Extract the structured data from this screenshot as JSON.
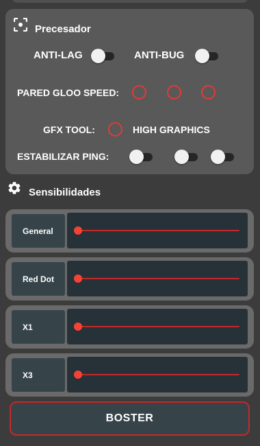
{
  "colors": {
    "background": "#3c3c3c",
    "panel": "#595959",
    "accent": "#e53935",
    "slider_bg": "#263238",
    "label_bg": "#36444a"
  },
  "processor": {
    "title": "Precesador",
    "icon": "focus-frame-icon",
    "anti_lag": {
      "label": "ANTI-LAG",
      "on": false
    },
    "anti_bug": {
      "label": "ANTI-BUG",
      "on": false
    },
    "pared_gloo_speed": {
      "label": "PARED GLOO SPEED:",
      "options_selected": [
        false,
        false,
        false
      ]
    },
    "gfx_tool": {
      "label": "GFX TOOL:",
      "option_label": "HIGH GRAPHICS",
      "selected": false
    },
    "estabilizar_ping": {
      "label": "ESTABILIZAR PING:",
      "toggles_on": [
        false,
        false,
        false
      ]
    }
  },
  "sensitivities": {
    "title": "Sensibilidades",
    "icon": "gear-icon",
    "sliders": [
      {
        "label": "General",
        "value": 0
      },
      {
        "label": "Red Dot",
        "value": 0
      },
      {
        "label": "X1",
        "value": 0
      },
      {
        "label": "X3",
        "value": 0
      }
    ]
  },
  "boost_button": {
    "label": "BOSTER"
  }
}
